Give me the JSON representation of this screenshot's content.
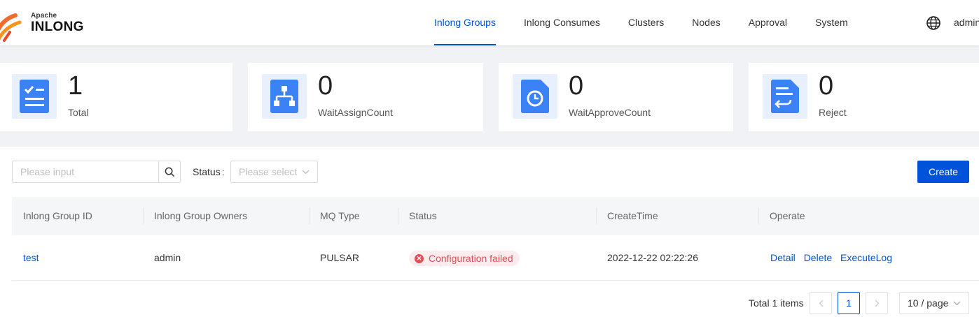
{
  "header": {
    "logo_top": "Apache",
    "logo_main": "INLONG",
    "nav": [
      {
        "label": "Inlong Groups",
        "active": true
      },
      {
        "label": "Inlong Consumes"
      },
      {
        "label": "Clusters"
      },
      {
        "label": "Nodes"
      },
      {
        "label": "Approval"
      },
      {
        "label": "System"
      }
    ],
    "user": "admin",
    "globe_icon": "globe-icon"
  },
  "stats": [
    {
      "value": "1",
      "label": "Total",
      "icon": "checklist-icon"
    },
    {
      "value": "0",
      "label": "WaitAssignCount",
      "icon": "hierarchy-icon"
    },
    {
      "value": "0",
      "label": "WaitApproveCount",
      "icon": "clock-document-icon"
    },
    {
      "value": "0",
      "label": "Reject",
      "icon": "return-document-icon"
    }
  ],
  "filters": {
    "search_placeholder": "Please input",
    "status_label": "Status",
    "status_placeholder": "Please select"
  },
  "create_label": "Create",
  "table": {
    "columns": [
      "Inlong Group ID",
      "Inlong Group Owners",
      "MQ Type",
      "Status",
      "CreateTime",
      "Operate"
    ],
    "rows": [
      {
        "id": "test",
        "owners": "admin",
        "mq_type": "PULSAR",
        "status": "Configuration failed",
        "create_time": "2022-12-22 02:22:26",
        "ops": [
          "Detail",
          "Delete",
          "ExecuteLog"
        ]
      }
    ]
  },
  "pagination": {
    "total_text": "Total 1 items",
    "current_page": "1",
    "page_size": "10 / page"
  },
  "colors": {
    "primary": "#0052d9",
    "error": "#e34d59",
    "icon_blue": "#3b82f6"
  }
}
